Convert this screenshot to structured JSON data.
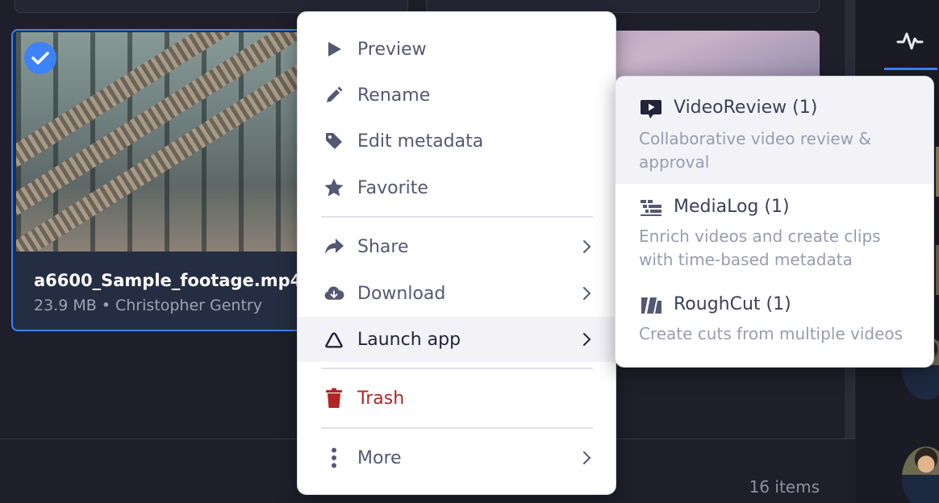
{
  "asset": {
    "name": "a6600_Sample_footage.mp4",
    "size": "23.9 MB",
    "separator": "•",
    "owner": "Christopher Gentry"
  },
  "footer": {
    "item_count": "16 items"
  },
  "context_menu": {
    "preview": "Preview",
    "rename": "Rename",
    "edit_metadata": "Edit metadata",
    "favorite": "Favorite",
    "share": "Share",
    "download": "Download",
    "launch_app": "Launch app",
    "trash": "Trash",
    "more": "More"
  },
  "launch_app_submenu": [
    {
      "icon": "video-review-icon",
      "title": "VideoReview (1)",
      "description": "Collaborative video review & approval"
    },
    {
      "icon": "medialog-icon",
      "title": "MediaLog (1)",
      "description": "Enrich videos and create clips with time-based metadata"
    },
    {
      "icon": "roughcut-icon",
      "title": "RoughCut (1)",
      "description": "Create cuts from multiple videos"
    }
  ],
  "colors": {
    "accent": "#3d82f6",
    "danger": "#b42424",
    "menu_text": "#555873",
    "background": "#1f1f2b"
  }
}
